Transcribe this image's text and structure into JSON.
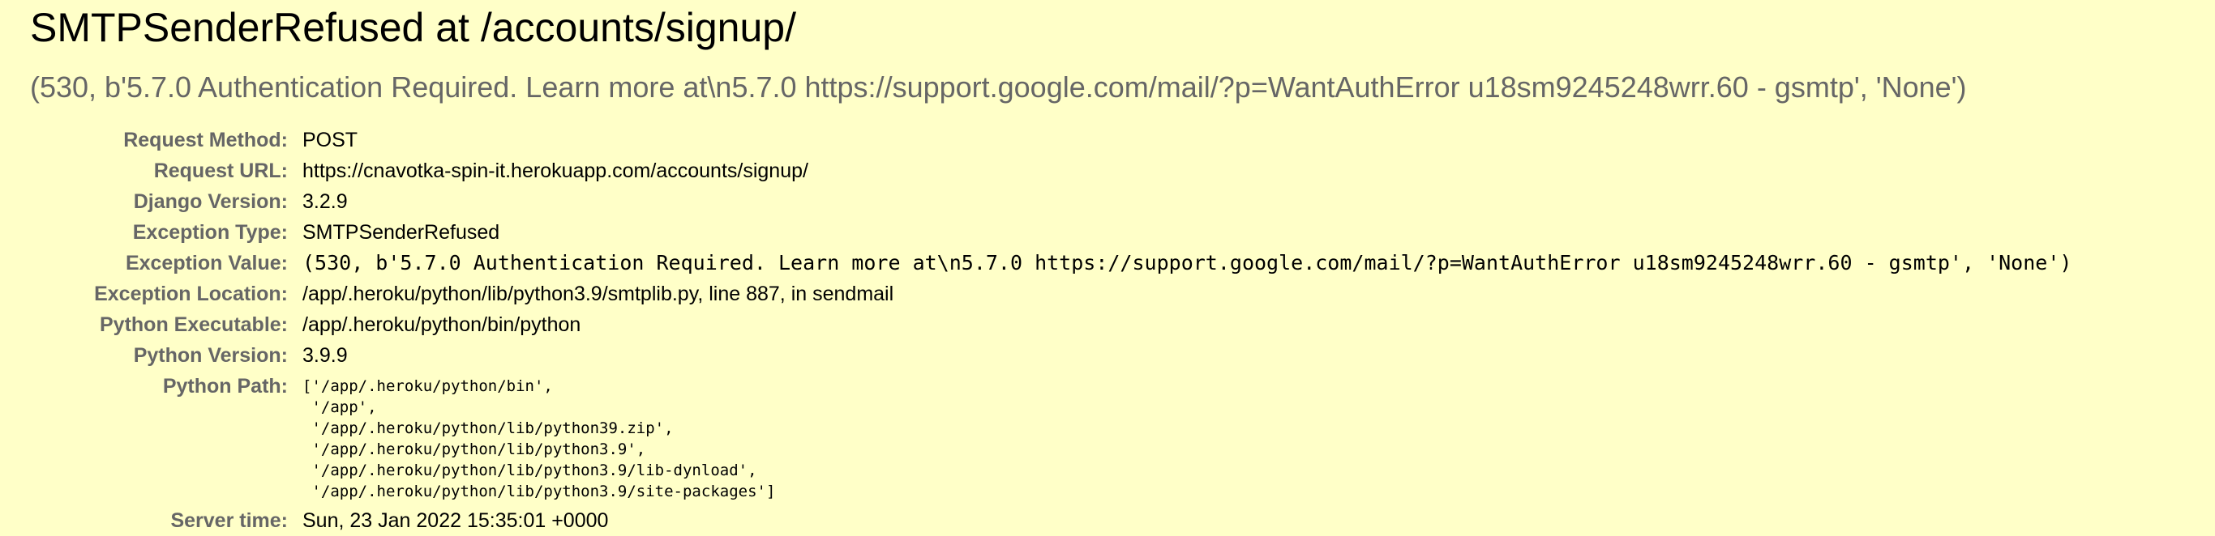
{
  "title": "SMTPSenderRefused at /accounts/signup/",
  "exception_message": "(530, b'5.7.0 Authentication Required. Learn more at\\n5.7.0  https://support.google.com/mail/?p=WantAuthError u18sm9245248wrr.60 - gsmtp', 'None')",
  "meta": {
    "request_method": {
      "label": "Request Method:",
      "value": "POST"
    },
    "request_url": {
      "label": "Request URL:",
      "value": "https://cnavotka-spin-it.herokuapp.com/accounts/signup/"
    },
    "django_version": {
      "label": "Django Version:",
      "value": "3.2.9"
    },
    "exception_type": {
      "label": "Exception Type:",
      "value": "SMTPSenderRefused"
    },
    "exception_value": {
      "label": "Exception Value:",
      "value": "(530, b'5.7.0 Authentication Required. Learn more at\\n5.7.0  https://support.google.com/mail/?p=WantAuthError u18sm9245248wrr.60 - gsmtp', 'None')"
    },
    "exception_location": {
      "label": "Exception Location:",
      "value": "/app/.heroku/python/lib/python3.9/smtplib.py, line 887, in sendmail"
    },
    "python_executable": {
      "label": "Python Executable:",
      "value": "/app/.heroku/python/bin/python"
    },
    "python_version": {
      "label": "Python Version:",
      "value": "3.9.9"
    },
    "python_path": {
      "label": "Python Path:",
      "value": "['/app/.heroku/python/bin',\n '/app',\n '/app/.heroku/python/lib/python39.zip',\n '/app/.heroku/python/lib/python3.9',\n '/app/.heroku/python/lib/python3.9/lib-dynload',\n '/app/.heroku/python/lib/python3.9/site-packages']"
    },
    "server_time": {
      "label": "Server time:",
      "value": "Sun, 23 Jan 2022 15:35:01 +0000"
    }
  },
  "colors": {
    "background": "#ffffc8",
    "label": "#666666",
    "message": "#666666"
  }
}
